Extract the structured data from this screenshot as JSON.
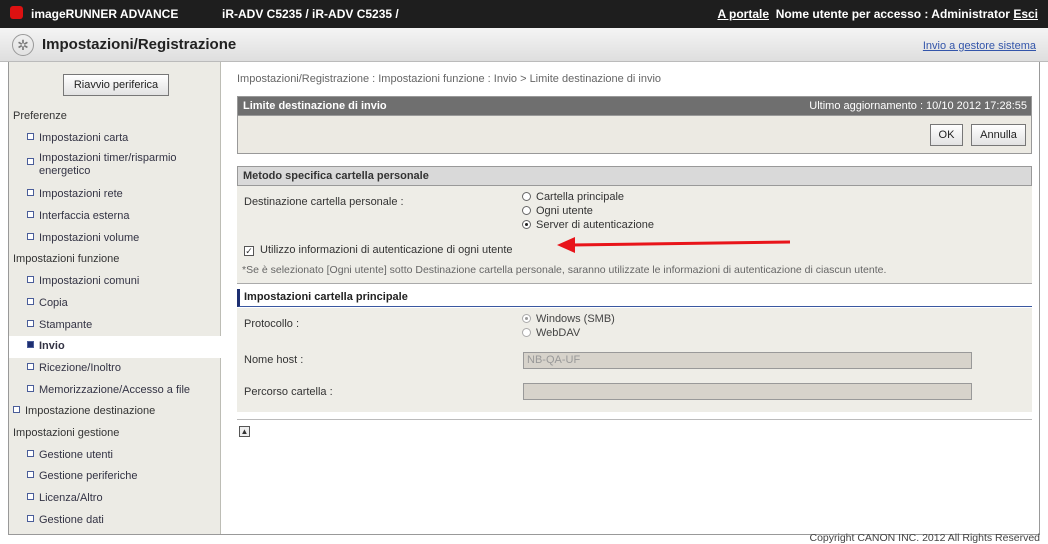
{
  "top": {
    "brand": "imageRUNNER ADVANCE",
    "device": "iR-ADV C5235 / iR-ADV C5235 /",
    "portal_link": "A portale",
    "user_label": "Nome utente per accesso : Administrator",
    "logout_link": "Esci"
  },
  "header": {
    "title": "Impostazioni/Registrazione",
    "manager_link": "Invio a gestore sistema"
  },
  "sidebar": {
    "restart_button": "Riavvio periferica",
    "items": [
      {
        "label": "Preferenze"
      },
      {
        "label": "Impostazioni carta"
      },
      {
        "label": "Impostazioni timer/risparmio energetico"
      },
      {
        "label": "Impostazioni rete"
      },
      {
        "label": "Interfaccia esterna"
      },
      {
        "label": "Impostazioni volume"
      },
      {
        "label": "Impostazioni funzione"
      },
      {
        "label": "Impostazioni comuni"
      },
      {
        "label": "Copia"
      },
      {
        "label": "Stampante"
      },
      {
        "label": "Invio"
      },
      {
        "label": "Ricezione/Inoltro"
      },
      {
        "label": "Memorizzazione/Accesso a file"
      },
      {
        "label": "Impostazione destinazione"
      },
      {
        "label": "Impostazioni gestione"
      },
      {
        "label": "Gestione utenti"
      },
      {
        "label": "Gestione periferiche"
      },
      {
        "label": "Licenza/Altro"
      },
      {
        "label": "Gestione dati"
      }
    ]
  },
  "main": {
    "breadcrumb": "Impostazioni/Registrazione : Impostazioni funzione : Invio > Limite destinazione di invio",
    "panel_title": "Limite destinazione di invio",
    "last_update": "Ultimo aggiornamento : 10/10 2012 17:28:55",
    "ok_button": "OK",
    "cancel_button": "Annulla",
    "section1": {
      "title": "Metodo specifica cartella personale",
      "dest_label": "Destinazione cartella personale :",
      "options": [
        "Cartella principale",
        "Ogni utente",
        "Server di autenticazione"
      ],
      "checkbox_label": "Utilizzo informazioni di autenticazione di ogni utente",
      "note": "*Se è selezionato [Ogni utente] sotto Destinazione cartella personale, saranno utilizzate le informazioni di autenticazione di ciascun utente."
    },
    "section2": {
      "title": "Impostazioni cartella principale",
      "protocol_label": "Protocollo :",
      "protocol_options": [
        "Windows (SMB)",
        "WebDAV"
      ],
      "host_label": "Nome host :",
      "host_value": "NB-QA-UF",
      "path_label": "Percorso cartella :",
      "path_value": ""
    }
  },
  "footer": {
    "copyright": "Copyright CANON INC. 2012 All Rights Reserved"
  },
  "colors": {
    "accent_navy": "#1d2e70",
    "arrow_red": "#e8141a",
    "titlebar": "#6f6f6f"
  }
}
